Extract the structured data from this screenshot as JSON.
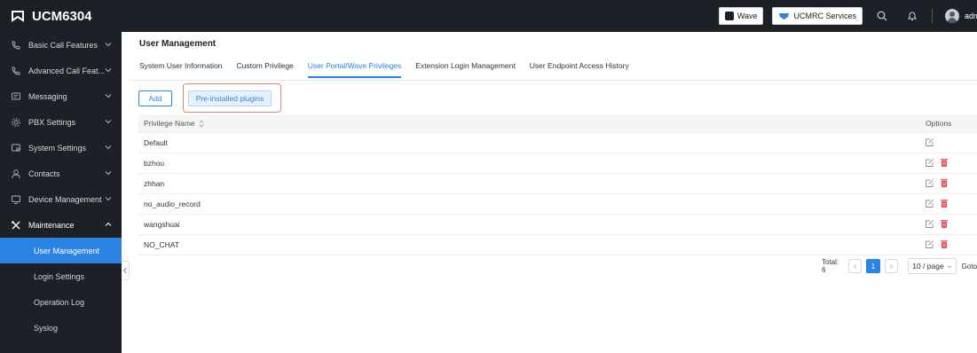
{
  "header": {
    "brand": "UCM6304",
    "wave_label": "Wave",
    "ucmrc_label": "UCMRC Services",
    "user": "admin"
  },
  "sidebar": {
    "items": [
      {
        "label": "Basic Call Features",
        "icon": "phone-gear-icon"
      },
      {
        "label": "Advanced Call Feat...",
        "icon": "phone-gear-icon"
      },
      {
        "label": "Messaging",
        "icon": "message-icon"
      },
      {
        "label": "PBX Settings",
        "icon": "gear-icon"
      },
      {
        "label": "System Settings",
        "icon": "system-settings-icon"
      },
      {
        "label": "Contacts",
        "icon": "contacts-icon"
      },
      {
        "label": "Device Management",
        "icon": "device-icon"
      },
      {
        "label": "Maintenance",
        "icon": "tools-icon"
      }
    ],
    "sub_items": [
      {
        "label": "User Management",
        "active": true
      },
      {
        "label": "Login Settings",
        "active": false
      },
      {
        "label": "Operation Log",
        "active": false
      },
      {
        "label": "Syslog",
        "active": false
      }
    ]
  },
  "page": {
    "title": "User Management",
    "tabs": [
      {
        "label": "System User Information",
        "active": false
      },
      {
        "label": "Custom Privilege",
        "active": false
      },
      {
        "label": "User Portal/Wave Privileges",
        "active": true
      },
      {
        "label": "Extension Login Management",
        "active": false
      },
      {
        "label": "User Endpoint Access History",
        "active": false
      }
    ],
    "add_label": "Add",
    "plugins_label": "Pre-installed plugins"
  },
  "table": {
    "col_name": "Privilege Name",
    "col_options": "Options",
    "rows": [
      {
        "name": "Default",
        "deletable": false
      },
      {
        "name": "bzhou",
        "deletable": true
      },
      {
        "name": "zhhan",
        "deletable": true
      },
      {
        "name": "no_audio_record",
        "deletable": true
      },
      {
        "name": "wangshuai",
        "deletable": true
      },
      {
        "name": "NO_CHAT",
        "deletable": true
      }
    ]
  },
  "pagination": {
    "total": "Total: 6",
    "current": "1",
    "page_size": "10 / page",
    "goto": "Goto"
  },
  "colors": {
    "accent": "#2b84e3",
    "sidebar_bg": "#1e2027",
    "delete": "#e5484d"
  }
}
